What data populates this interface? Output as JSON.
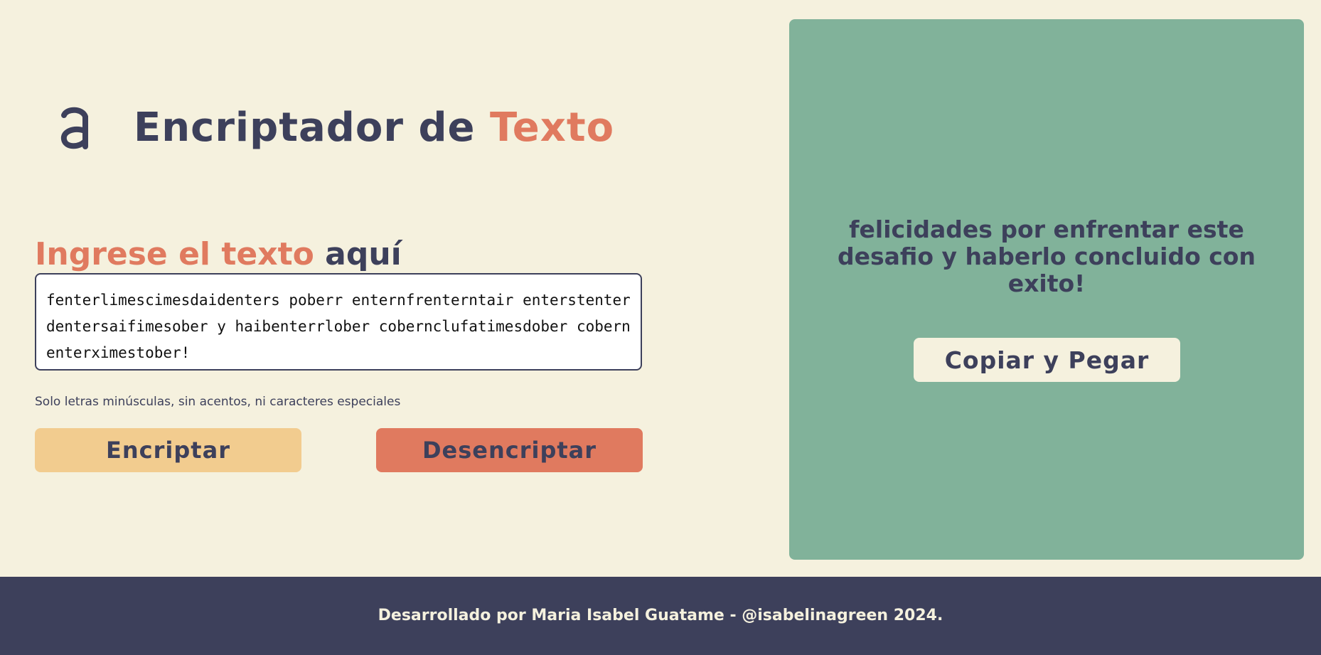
{
  "header": {
    "logo_icon": "alura-a-logo-icon",
    "title_main": "Encriptador de ",
    "title_accent": "Texto"
  },
  "input": {
    "heading_part1": "Ingrese el texto ",
    "heading_part2": "aquí",
    "value": "fenterlimescimesdaidenters poberr enternfrenterntair enterstenter dentersaifimesober y haibenterrlober cobernclufatimesdober cobern enterximestober!",
    "hint": "Solo letras minúsculas, sin acentos, ni caracteres especiales"
  },
  "actions": {
    "encrypt_label": "Encriptar",
    "decrypt_label": "Desencriptar"
  },
  "output": {
    "message": "felicidades por enfrentar este desafio y haberlo concluido con exito!",
    "copy_label": "Copiar y Pegar"
  },
  "footer": {
    "text": "Desarrollado por Maria Isabel Guatame - @isabelinagreen 2024."
  },
  "colors": {
    "background": "#F5F1DE",
    "primary_text": "#3D405B",
    "accent": "#E07A5F",
    "encrypt_button": "#F2CC8F",
    "output_panel": "#81B29A",
    "footer": "#3D405B"
  }
}
